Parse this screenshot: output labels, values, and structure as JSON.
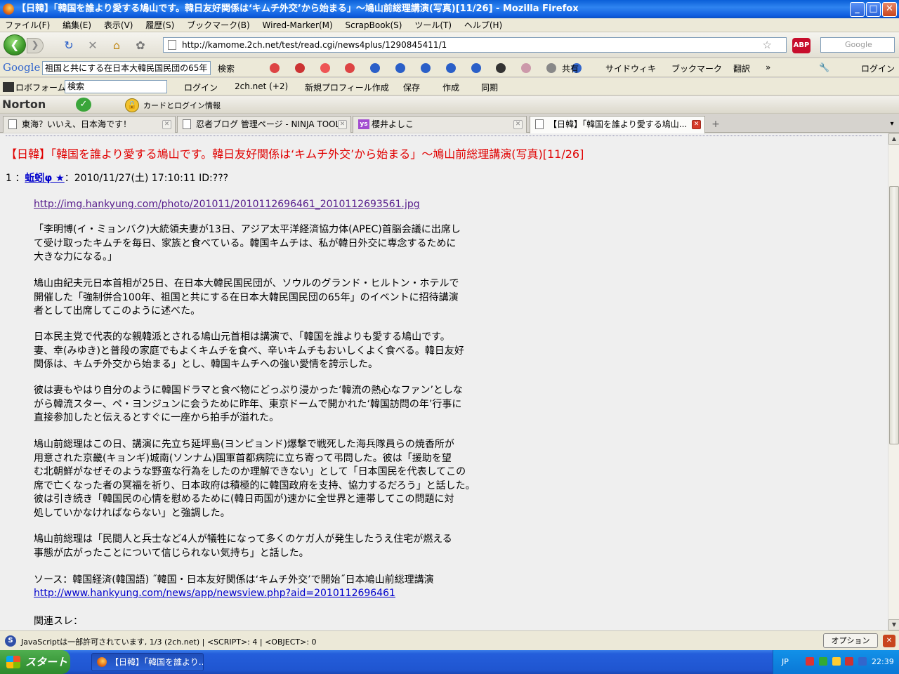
{
  "window": {
    "title": "【日韓】「韓国を誰より愛する鳩山です。韓日友好関係は‘キムチ外交’から始まる」〜鳩山前総理講演(写真)[11/26] - Mozilla Firefox",
    "minimize": "_",
    "maximize": "□",
    "close": "✕"
  },
  "menu": [
    "ファイル(F)",
    "編集(E)",
    "表示(V)",
    "履歴(S)",
    "ブックマーク(B)",
    "Wired-Marker(M)",
    "ScrapBook(S)",
    "ツール(T)",
    "ヘルプ(H)"
  ],
  "nav": {
    "back": "❮",
    "forward": "❯",
    "reload": "↻",
    "stop": "✕",
    "home": "⌂",
    "url": "http://kamome.2ch.net/test/read.cgi/news4plus/1290845411/1",
    "abp": "ABP",
    "search_placeholder": "Google"
  },
  "google_toolbar": {
    "logo": "Google",
    "query": "祖国と共にする在日本大韓民国民団の65年",
    "search_label": "検索",
    "share_label": "共有",
    "sidewiki_label": "サイドウィキ",
    "bookmarks_label": "ブックマーク",
    "translate_label": "翻訳",
    "more": "»",
    "login_label": "ログイン"
  },
  "form_toolbar": {
    "roboform": "ロボフォーム",
    "search_value": "検索",
    "login": "ログイン",
    "twoch": "2ch.net (+2)",
    "new_profile": "新規プロフィール作成",
    "save": "保存",
    "create": "作成",
    "sync": "同期"
  },
  "norton": {
    "logo": "Norton",
    "card_info": "カードとログイン情報"
  },
  "tabs": [
    {
      "label": "東海？いいえ、日本海です！",
      "active": false
    },
    {
      "label": "忍者ブログ 管理ページ - NINJA TOOLS",
      "active": false
    },
    {
      "label": "櫻井よしこ",
      "active": false
    },
    {
      "label": "【日韓】「韓国を誰より愛する鳩山...",
      "active": true
    }
  ],
  "post": {
    "thread_title": "【日韓】「韓国を誰より愛する鳩山です。韓日友好関係は‘キムチ外交’から始まる」〜鳩山前総理講演(写真)[11/26]",
    "number": "1 ：",
    "poster": "蚯蚓φ ★",
    "meta": "：2010/11/27(土) 17:10:11 ID:???",
    "photo_link": "http://img.hankyung.com/photo/201011/2010112696461_2010112693561.jpg",
    "paragraphs": [
      [
        "「李明博(イ・ミョンバク)大統領夫妻が13日、アジア太平洋経済協力体(APEC)首脳会議に出席し",
        "て受け取ったキムチを毎日、家族と食べている。韓国キムチは、私が韓日外交に専念するために",
        "大きな力になる。」"
      ],
      [
        "鳩山由紀夫元日本首相が25日、在日本大韓民国民団が、ソウルのグランド・ヒルトン・ホテルで",
        "開催した「強制併合100年、祖国と共にする在日本大韓民国民団の65年」のイベントに招待講演",
        "者として出席してこのように述べた。"
      ],
      [
        "日本民主党で代表的な親韓派とされる鳩山元首相は講演で、「韓国を誰よりも愛する鳩山です。",
        "妻、幸(みゆき)と普段の家庭でもよくキムチを食べ、辛いキムチもおいしくよく食べる。韓日友好",
        "関係は、キムチ外交から始まる」とし、韓国キムチへの強い愛情を誇示した。"
      ],
      [
        "彼は妻もやはり自分のように韓国ドラマと食べ物にどっぷり浸かった‘韓流の熱心なファン’としな",
        "がら韓流スター、ペ・ヨンジュンに会うために昨年、東京ドームで開かれた‘韓国訪問の年’行事に",
        "直接参加したと伝えるとすぐに一座から拍手が溢れた。"
      ],
      [
        "鳩山前総理はこの日、講演に先立ち延坪島(ヨンピョンド)爆撃で戦死した海兵隊員らの焼香所が",
        "用意された京畿(キョンギ)城南(ソンナム)国軍首都病院に立ち寄って弔問した。彼は「援助を望",
        "む北朝鮮がなぜそのような野蛮な行為をしたのか理解できない」として「日本国民を代表してこの",
        "席で亡くなった者の冥福を祈り、日本政府は積極的に韓国政府を支持、協力するだろう」と話した。",
        "彼は引き続き「韓国民の心情を慰めるために(韓日両国が)速かに全世界と連帯してこの問題に対",
        "処していかなければならない」と強調した。"
      ],
      [
        "鳩山前総理は「民間人と兵士など4人が犠牲になって多くのケガ人が発生したうえ住宅が燃える",
        "事態が広がったことについて信じられない気持ち」と話した。"
      ]
    ],
    "source": "ソース：韓国経済(韓国語) ˝韓国・日本友好関係は‘キムチ外交’で開始˝日本鳩山前総理講演",
    "source_link": "http://www.hankyung.com/news/app/newsview.php?aid=2010112696461",
    "related": "関連スレ："
  },
  "status": {
    "text": "JavaScriptは一部許可されています, 1/3 (2ch.net) | <SCRIPT>: 4 | <OBJECT>: 0",
    "options": "オプション(O)...",
    "close": "✕"
  },
  "taskbar": {
    "start": "スタート",
    "window_button": "【日韓】「韓国を誰より...",
    "lang": "JP",
    "clock": "22:39"
  }
}
